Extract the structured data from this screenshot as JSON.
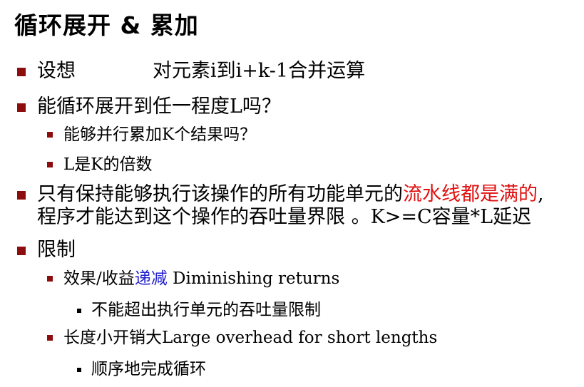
{
  "title": "循环展开 & 累加",
  "bullets": {
    "b1_label": "设想",
    "b1_text": "对元素i到i+k-1合并运算",
    "b2": "能循环展开到任一程度L吗？",
    "b2_sub1": "能够并行累加K个结果吗？",
    "b2_sub2": "L是K的倍数",
    "b3_pre": "只有保持能够执行该操作的所有功能单元的",
    "b3_red": "流水线都是满的",
    "b3_post": ",",
    "b3_line2": "程序才能达到这个操作的吞吐量界限 。K>=C容量*L延迟",
    "b4": "限制",
    "b4_sub1_pre": "效果/收益",
    "b4_sub1_blue": "递减",
    "b4_sub1_post": " Diminishing returns",
    "b4_sub1_sub": "不能超出执行单元的吞吐量限制",
    "b4_sub2": "长度小开销大Large overhead for short lengths",
    "b4_sub2_sub": "顺序地完成循环"
  },
  "colors": {
    "bullet": "#8b0d0d",
    "highlight_red": "#e01010",
    "highlight_blue": "#2222cc"
  }
}
